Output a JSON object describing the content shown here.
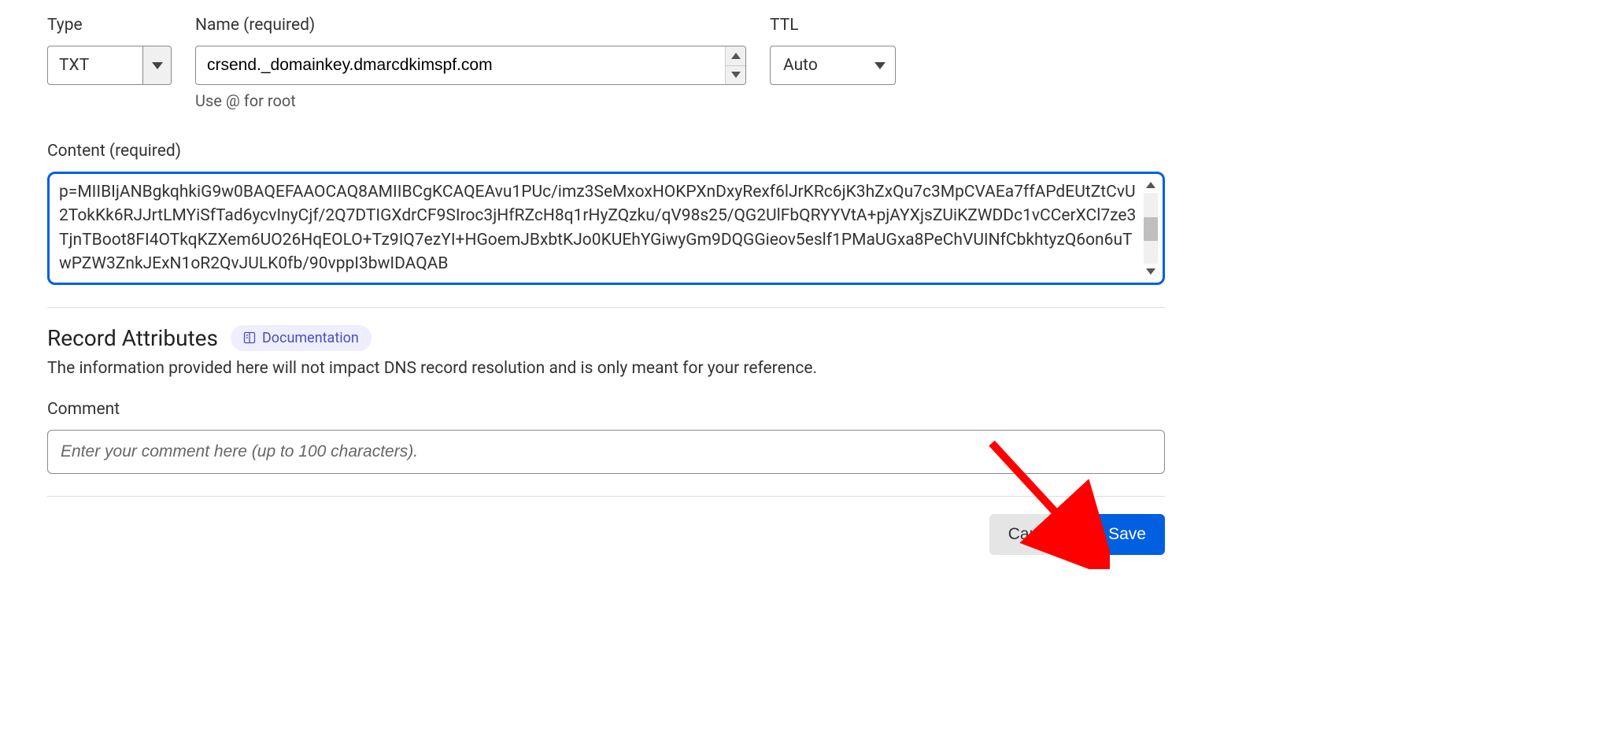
{
  "fields": {
    "type": {
      "label": "Type",
      "value": "TXT"
    },
    "name": {
      "label": "Name (required)",
      "value": "crsend._domainkey.dmarcdkimspf.com",
      "helper": "Use @ for root"
    },
    "ttl": {
      "label": "TTL",
      "value": "Auto"
    },
    "content": {
      "label": "Content (required)",
      "value": "p=MIIBIjANBgkqhkiG9w0BAQEFAAOCAQ8AMIIBCgKCAQEAvu1PUc/imz3SeMxoxHOKPXnDxyRexf6lJrKRc6jK3hZxQu7c3MpCVAEa7ffAPdEUtZtCvU2TokKk6RJJrtLMYiSfTad6ycvInyCjf/2Q7DTIGXdrCF9SIroc3jHfRZcH8q1rHyZQzku/qV98s25/QG2UlFbQRYYVtA+pjAYXjsZUiKZWDDc1vCCerXCl7ze3TjnTBoot8FI4OTkqKZXem6UO26HqEOLO+Tz9IQ7ezYI+HGoemJBxbtKJo0KUEhYGiwyGm9DQGGieov5eslf1PMaUGxa8PeChVUINfCbkhtyzQ6on6uTwPZW3ZnkJExN1oR2QvJULK0fb/90vppI3bwIDAQAB"
    }
  },
  "attributes": {
    "title": "Record Attributes",
    "docLabel": "Documentation",
    "description": "The information provided here will not impact DNS record resolution and is only meant for your reference.",
    "commentLabel": "Comment",
    "commentPlaceholder": "Enter your comment here (up to 100 characters)."
  },
  "buttons": {
    "cancel": "Cancel",
    "save": "Save"
  }
}
